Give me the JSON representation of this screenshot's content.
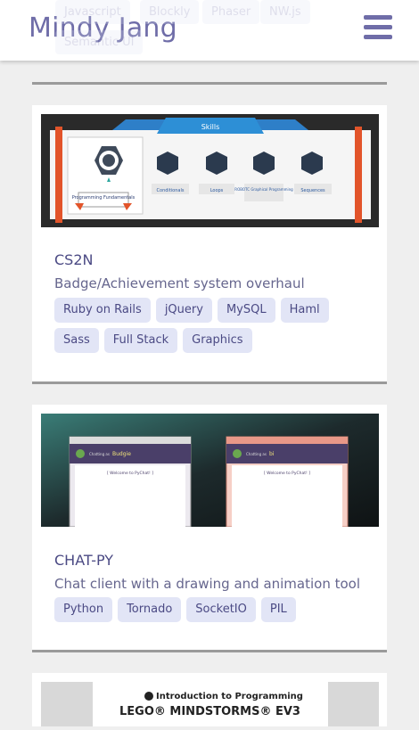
{
  "header": {
    "brand": "Mindy Jang",
    "menu_icon": "hamburger-menu-icon"
  },
  "previous_card_tags": [
    "Javascript",
    "Blockly",
    "Phaser",
    "NW.js",
    "Semantic UI"
  ],
  "projects": [
    {
      "title": "CS2N",
      "description": "Badge/Achievement system overhaul",
      "tags": [
        "Ruby on Rails",
        "jQuery",
        "MySQL",
        "Haml",
        "Sass",
        "Full Stack",
        "Graphics"
      ],
      "thumb": {
        "banner": "Skills",
        "main_badge": "Programming Fundamentals",
        "badges": [
          "Conditionals",
          "Loops",
          "ROBOTC Graphical Programming",
          "Sequences"
        ]
      }
    },
    {
      "title": "CHAT-PY",
      "description": "Chat client with a drawing and animation tool",
      "tags": [
        "Python",
        "Tornado",
        "SocketIO",
        "PIL"
      ],
      "thumb": {
        "left_title": "Chatting as",
        "left_user": "Budgie",
        "right_title": "Chatting as",
        "right_user": "bi",
        "welcome": "[ Welcome to PyChat! ]"
      }
    },
    {
      "thumb": {
        "headline": "Introduction to Programming",
        "subheadline": "LEGO® MINDSTORMS® EV3"
      }
    }
  ]
}
